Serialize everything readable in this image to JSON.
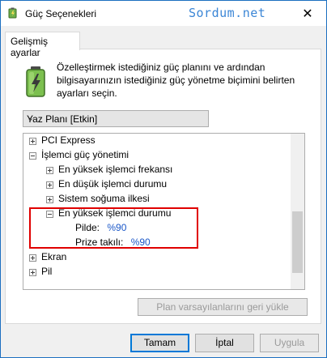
{
  "window": {
    "title": "Güç Seçenekleri",
    "watermark": "Sordum.net",
    "close_symbol": "✕"
  },
  "tabs": [
    {
      "label": "Gelişmiş ayarlar"
    }
  ],
  "description": "Özelleştirmek istediğiniz güç planını ve ardından bilgisayarınızın istediğiniz güç yönetme biçimini belirten ayarları seçin.",
  "plan_select": {
    "value": "Yaz Planı [Etkin]",
    "chevron": "⌄"
  },
  "tree": {
    "items": [
      {
        "label": "PCI Express",
        "expander": "plus"
      },
      {
        "label": "İşlemci güç yönetimi",
        "expander": "minus"
      },
      {
        "label": "En yüksek işlemci frekansı",
        "expander": "plus"
      },
      {
        "label": "En düşük işlemci durumu",
        "expander": "plus"
      },
      {
        "label": "Sistem soğuma ilkesi",
        "expander": "plus"
      },
      {
        "label": "En yüksek işlemci durumu",
        "expander": "minus"
      },
      {
        "label": "Pilde:",
        "value": "%90"
      },
      {
        "label": "Prize takılı:",
        "value": "%90"
      },
      {
        "label": "Ekran",
        "expander": "plus"
      },
      {
        "label": "Pil",
        "expander": "plus"
      }
    ]
  },
  "buttons": {
    "restore_defaults": "Plan varsayılanlarını geri yükle",
    "ok": "Tamam",
    "cancel": "İptal",
    "apply": "Uygula"
  },
  "colors": {
    "accent": "#0078d7",
    "highlight_border": "#e00000",
    "value_text": "#1a57c8"
  }
}
